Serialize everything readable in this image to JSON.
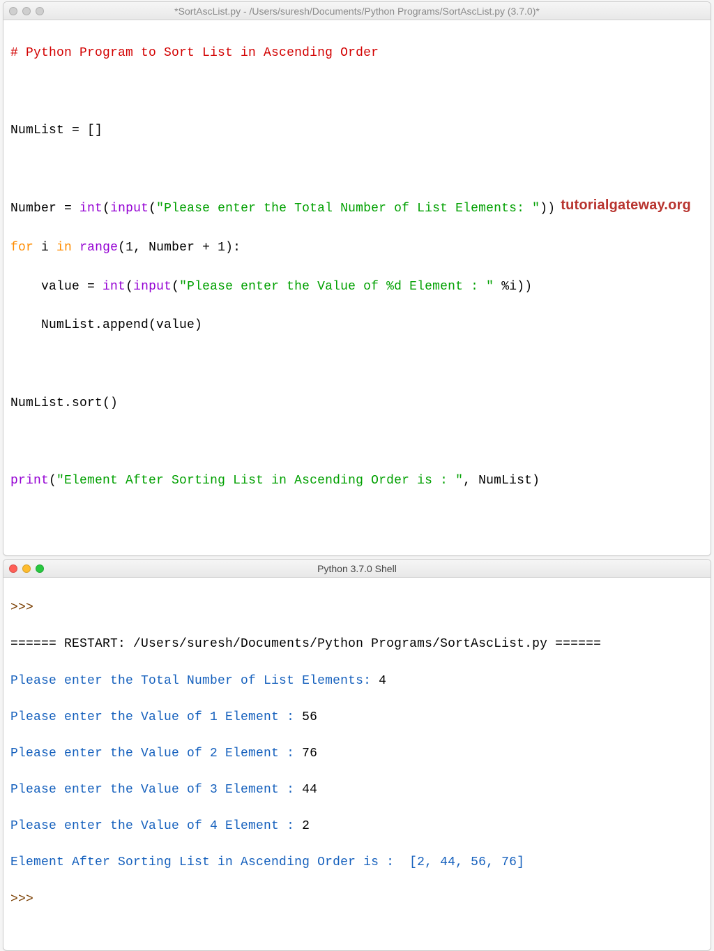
{
  "editor": {
    "title": "*SortAscList.py - /Users/suresh/Documents/Python Programs/SortAscList.py (3.7.0)*",
    "watermark": "tutorialgateway.org",
    "code": {
      "l1_comment": "# Python Program to Sort List in Ascending Order",
      "l3_lhs": "NumList ",
      "l3_eq": "= []",
      "l5_lhs": "Number ",
      "l5_eq": "= ",
      "l5_int": "int",
      "l5_paren1": "(",
      "l5_input": "input",
      "l5_paren2": "(",
      "l5_str": "\"Please enter the Total Number of List Elements: \"",
      "l5_close": "))",
      "l6_for": "for",
      "l6_sp1": " i ",
      "l6_in": "in",
      "l6_sp2": " ",
      "l6_range": "range",
      "l6_args": "(",
      "l6_one": "1",
      "l6_rest": ", Number + ",
      "l6_one2": "1",
      "l6_close": "):",
      "l7_indent": "    value ",
      "l7_eq": "= ",
      "l7_int": "int",
      "l7_p1": "(",
      "l7_input": "input",
      "l7_p2": "(",
      "l7_str": "\"Please enter the Value of %d Element : \"",
      "l7_mod": " %i))",
      "l8": "    NumList.append(value)",
      "l10": "NumList.sort()",
      "l12_print": "print",
      "l12_p1": "(",
      "l12_str": "\"Element After Sorting List in Ascending Order is : \"",
      "l12_rest": ", NumList)"
    }
  },
  "shell": {
    "title": "Python 3.7.0 Shell",
    "prompt": ">>> ",
    "restart_pre": "====== RESTART: ",
    "restart_path": "/Users/suresh/Documents/Python Programs/SortAscList.py",
    "restart_post": " ======",
    "io": [
      {
        "prompt": "Please enter the Total Number of List Elements: ",
        "input": "4"
      },
      {
        "prompt": "Please enter the Value of 1 Element : ",
        "input": "56"
      },
      {
        "prompt": "Please enter the Value of 2 Element : ",
        "input": "76"
      },
      {
        "prompt": "Please enter the Value of 3 Element : ",
        "input": "44"
      },
      {
        "prompt": "Please enter the Value of 4 Element : ",
        "input": "2"
      }
    ],
    "result_label": "Element After Sorting List in Ascending Order is :  ",
    "result_value": "[2, 44, 56, 76]",
    "prompt2": ">>> "
  }
}
